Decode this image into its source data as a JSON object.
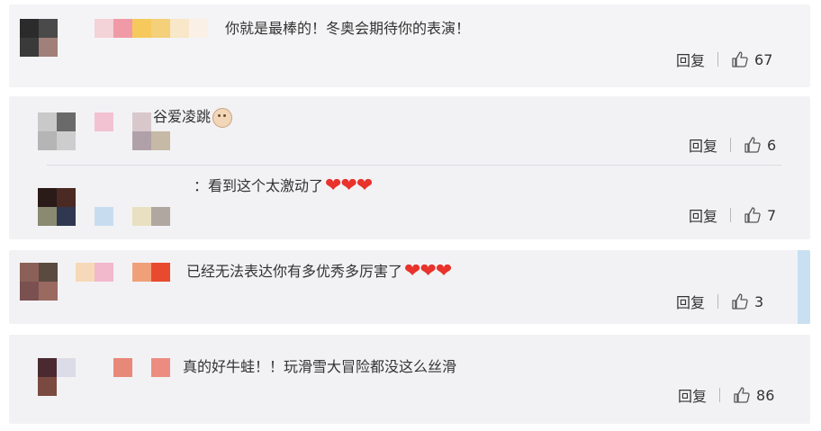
{
  "comments": [
    {
      "text": "你就是最棒的！冬奥会期待你的表演！",
      "reply_label": "回复",
      "like_count": "67"
    },
    {
      "text": "谷爱凌跳",
      "reply_label": "回复",
      "like_count": "6",
      "emoji": "doge-emoji",
      "reply": {
        "text": "：看到这个太激动了",
        "reply_label": "回复",
        "like_count": "7"
      }
    },
    {
      "text": "已经无法表达你有多优秀多厉害了",
      "reply_label": "回复",
      "like_count": "3"
    },
    {
      "text": "真的好牛蛙！！玩滑雪大冒险都没这么丝滑",
      "reply_label": "回复",
      "like_count": "86"
    }
  ],
  "icons": {
    "like": "thumbs-up-icon",
    "heart": "red-heart-emoji"
  },
  "colors": {
    "background": "#ffffff",
    "card": "#f2f2f5",
    "heart": "#e8322b",
    "scroll_rail": "#c8e0f2"
  }
}
